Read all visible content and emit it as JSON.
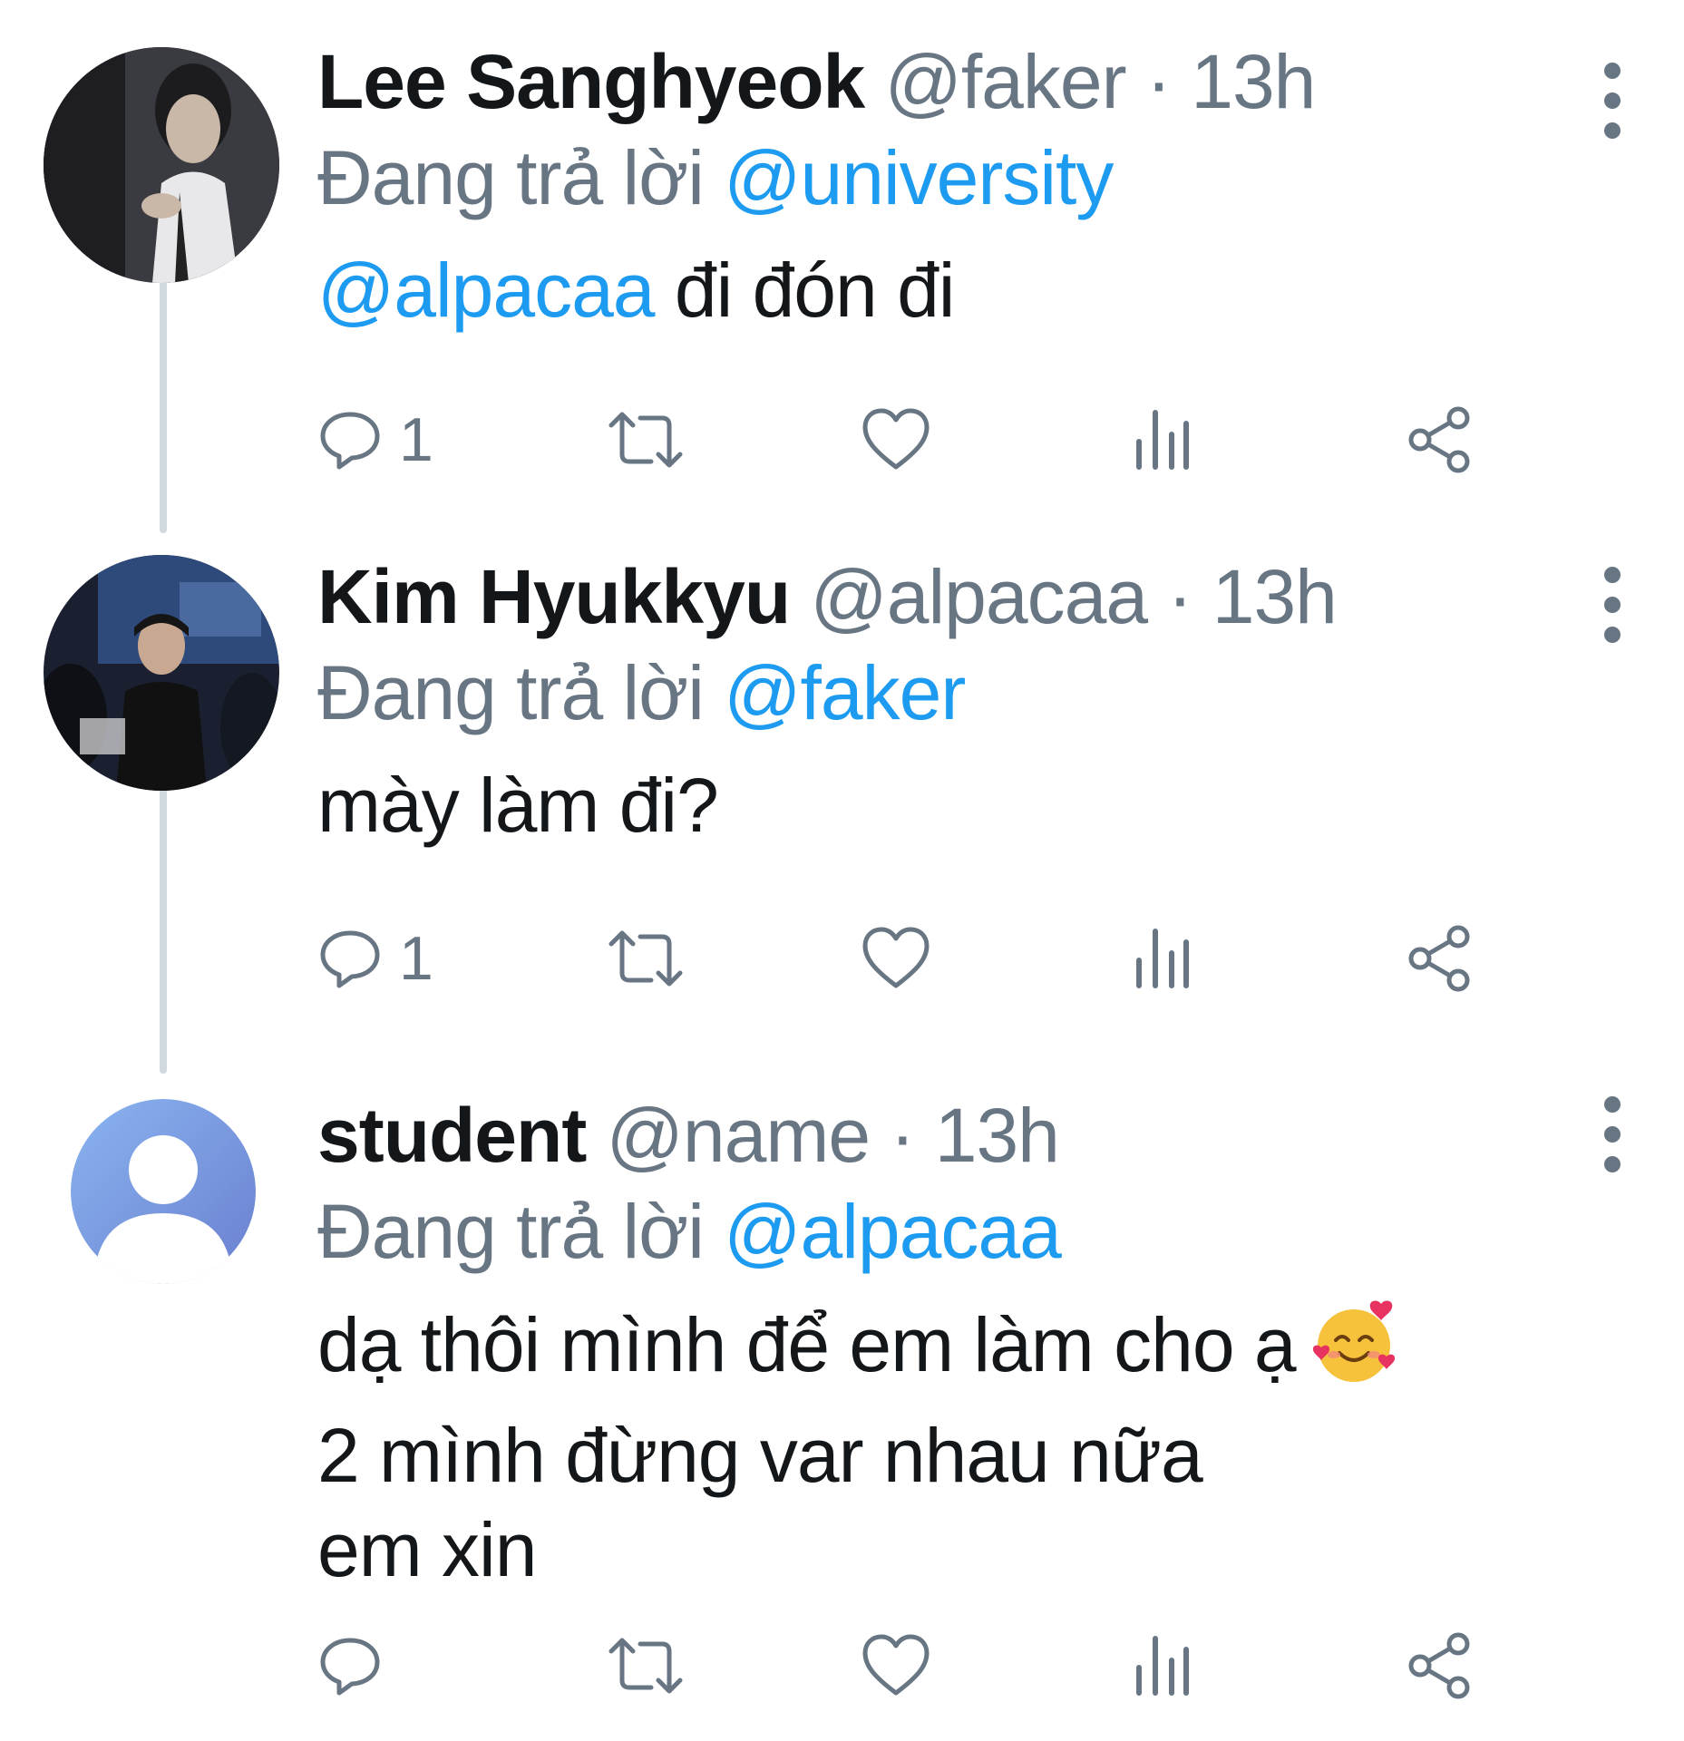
{
  "tweets": [
    {
      "name": "Lee Sanghyeok",
      "handle": "@faker",
      "separator": "·",
      "time": "13h",
      "replying_prefix": "Đang trả lời",
      "replying_to": "@university",
      "text_mention": "@alpacaa",
      "text": " đi đón đi",
      "reply_count": "1",
      "avatar": "photo-avatar"
    },
    {
      "name": "Kim Hyukkyu",
      "handle": "@alpacaa",
      "separator": "·",
      "time": "13h",
      "replying_prefix": "Đang trả lời",
      "replying_to": "@faker",
      "text": "mày làm đi?",
      "reply_count": "1",
      "avatar": "photo-avatar"
    },
    {
      "name": "student",
      "handle": "@name",
      "separator": "·",
      "time": "13h",
      "replying_prefix": "Đang trả lời",
      "replying_to": "@alpacaa",
      "text_lines": [
        "dạ thôi mình để em làm cho ạ",
        "2 mình đừng var nhau nữa",
        "em xin"
      ],
      "emoji": "smiling-face-with-hearts",
      "reply_count": "",
      "avatar": "default-user-avatar"
    }
  ],
  "icons": {
    "reply": "reply-icon",
    "retweet": "retweet-icon",
    "like": "heart-icon",
    "views": "views-icon",
    "share": "share-icon",
    "more": "more-icon"
  },
  "colors": {
    "text": "#14171a",
    "secondary": "#687684",
    "link": "#1d9bf0",
    "thread_line": "#cfd9de"
  }
}
